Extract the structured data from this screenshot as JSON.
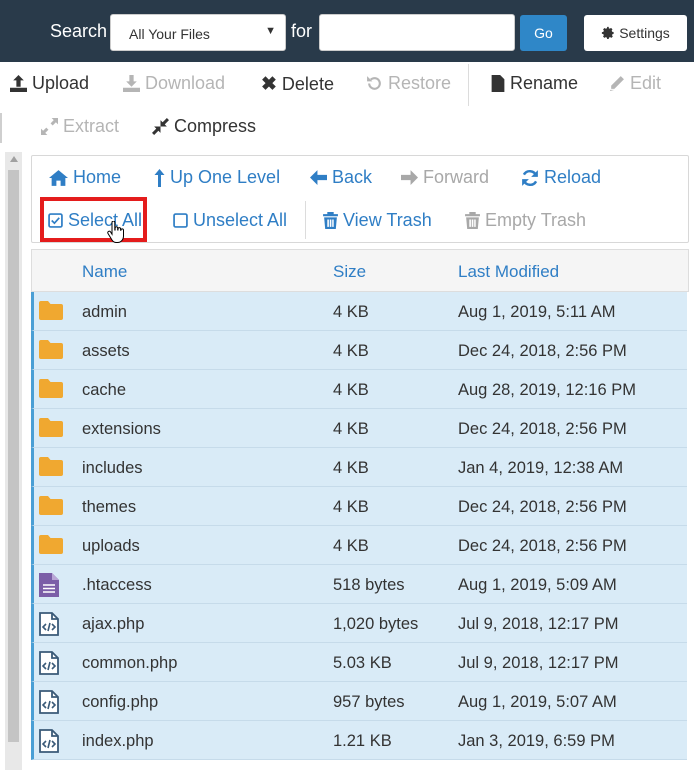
{
  "search": {
    "label": "Search",
    "scope_value": "All Your Files",
    "for_label": "for",
    "query_value": "",
    "go_label": "Go",
    "settings_label": "Settings"
  },
  "toolbar": {
    "upload": "Upload",
    "download": "Download",
    "delete": "Delete",
    "restore": "Restore",
    "rename": "Rename",
    "edit": "Edit",
    "extract": "Extract",
    "compress": "Compress"
  },
  "nav": {
    "home": "Home",
    "up_one_level": "Up One Level",
    "back": "Back",
    "forward": "Forward",
    "reload": "Reload",
    "select_all": "Select All",
    "unselect_all": "Unselect All",
    "view_trash": "View Trash",
    "empty_trash": "Empty Trash"
  },
  "table": {
    "headers": {
      "name": "Name",
      "size": "Size",
      "modified": "Last Modified"
    },
    "rows": [
      {
        "name": "admin",
        "size": "4 KB",
        "modified": "Aug 1, 2019, 5:11 AM",
        "icon": "folder-icon"
      },
      {
        "name": "assets",
        "size": "4 KB",
        "modified": "Dec 24, 2018, 2:56 PM",
        "icon": "folder-icon"
      },
      {
        "name": "cache",
        "size": "4 KB",
        "modified": "Aug 28, 2019, 12:16 PM",
        "icon": "folder-icon"
      },
      {
        "name": "extensions",
        "size": "4 KB",
        "modified": "Dec 24, 2018, 2:56 PM",
        "icon": "folder-icon"
      },
      {
        "name": "includes",
        "size": "4 KB",
        "modified": "Jan 4, 2019, 12:38 AM",
        "icon": "folder-icon"
      },
      {
        "name": "themes",
        "size": "4 KB",
        "modified": "Dec 24, 2018, 2:56 PM",
        "icon": "folder-icon"
      },
      {
        "name": "uploads",
        "size": "4 KB",
        "modified": "Dec 24, 2018, 2:56 PM",
        "icon": "folder-icon"
      },
      {
        "name": ".htaccess",
        "size": "518 bytes",
        "modified": "Aug 1, 2019, 5:09 AM",
        "icon": "text-file-icon"
      },
      {
        "name": "ajax.php",
        "size": "1,020 bytes",
        "modified": "Jul 9, 2018, 12:17 PM",
        "icon": "code-file-icon"
      },
      {
        "name": "common.php",
        "size": "5.03 KB",
        "modified": "Jul 9, 2018, 12:17 PM",
        "icon": "code-file-icon"
      },
      {
        "name": "config.php",
        "size": "957 bytes",
        "modified": "Aug 1, 2019, 5:07 AM",
        "icon": "code-file-icon"
      },
      {
        "name": "index.php",
        "size": "1.21 KB",
        "modified": "Jan 3, 2019, 6:59 PM",
        "icon": "code-file-icon"
      }
    ]
  },
  "colors": {
    "topbar": "#293a4a",
    "accent": "#2f7ec5",
    "selected_row": "#d9ebf7",
    "highlight": "#e41c1c",
    "folder": "#f0a830",
    "text_file": "#7b5ea7",
    "code_file": "#3a5a78"
  }
}
